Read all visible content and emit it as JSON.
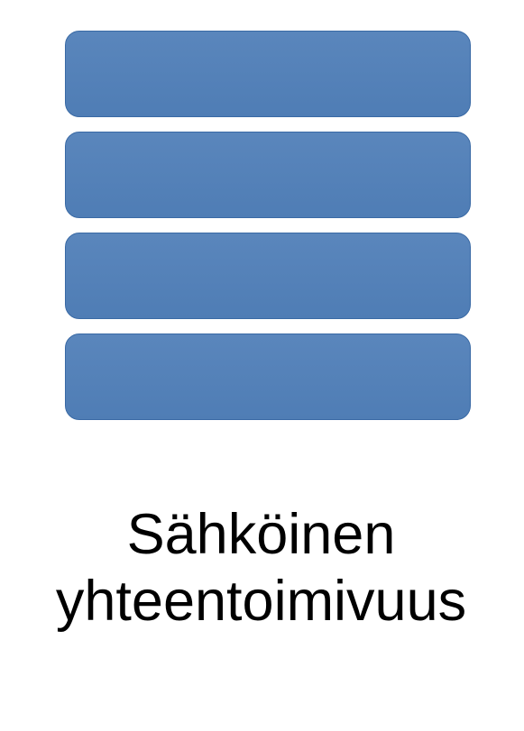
{
  "diagram": {
    "bars": [
      {
        "color": "#5280b8"
      },
      {
        "color": "#5280b8"
      },
      {
        "color": "#5280b8"
      },
      {
        "color": "#5280b8"
      }
    ],
    "caption_line1": "Sähköinen",
    "caption_line2": "yhteentoimivuus"
  }
}
